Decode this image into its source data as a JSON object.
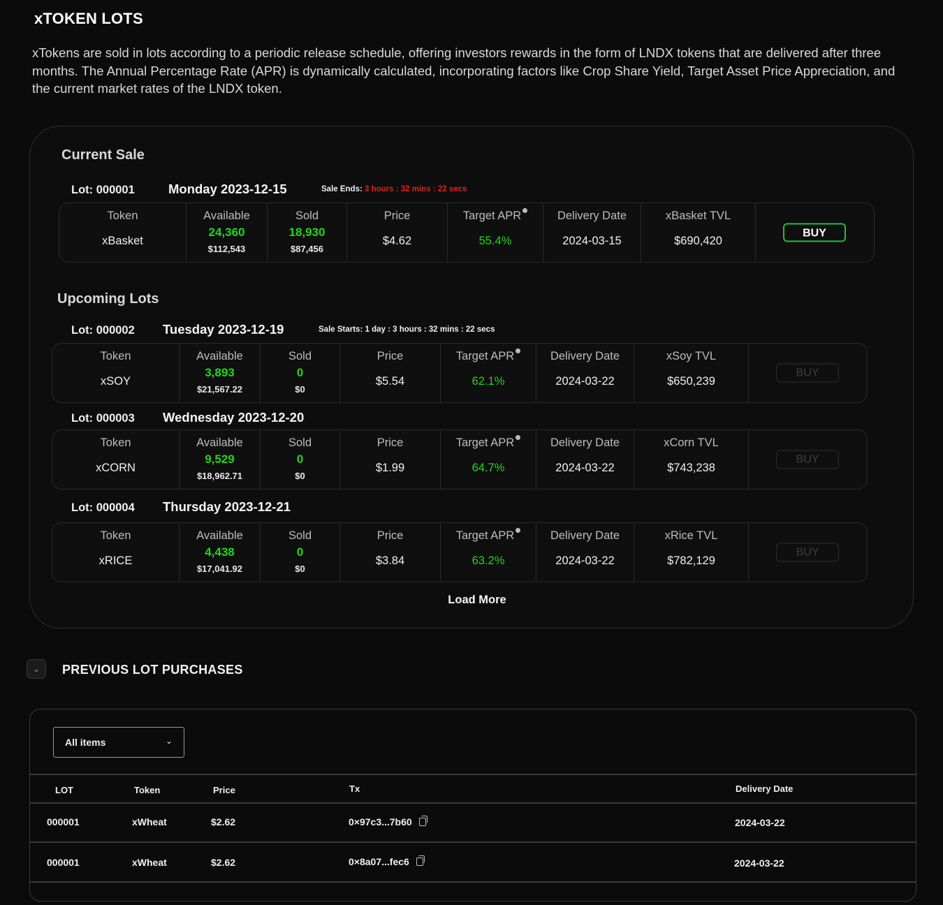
{
  "header": {
    "title": "xTOKEN LOTS",
    "description": "xTokens are sold in lots according to a periodic release schedule, offering investors rewards in the form of LNDX tokens that are delivered after three months. The Annual Percentage Rate (APR) is dynamically calculated, incorporating factors like Crop Share Yield, Target Asset Price Appreciation, and the current market rates of the LNDX token."
  },
  "current_sale": {
    "section_title": "Current Sale",
    "lot_label": "Lot: 000001",
    "date": "Monday 2023-12-15",
    "sale_ends_label": "Sale Ends:",
    "sale_ends_value": "3 hours : 32 mins : 22 secs",
    "row": {
      "token_label": "Token",
      "token": "xBasket",
      "available_label": "Available",
      "available": "24,360",
      "available_usd": "$112,543",
      "sold_label": "Sold",
      "sold": "18,930",
      "sold_usd": "$87,456",
      "price_label": "Price",
      "price": "$4.62",
      "apr_label": "Target APR",
      "apr": "55.4%",
      "delivery_label": "Delivery Date",
      "delivery": "2024-03-15",
      "tvl_label": "xBasket TVL",
      "tvl": "$690,420",
      "buy_label": "BUY"
    }
  },
  "upcoming": {
    "section_title": "Upcoming Lots",
    "lots": [
      {
        "lot_label": "Lot: 000002",
        "date": "Tuesday 2023-12-19",
        "sale_starts": "Sale Starts: 1 day : 3 hours : 32 mins : 22 secs",
        "token_label": "Token",
        "token": "xSOY",
        "available_label": "Available",
        "available": "3,893",
        "available_usd": "$21,567.22",
        "sold_label": "Sold",
        "sold": "0",
        "sold_usd": "$0",
        "price_label": "Price",
        "price": "$5.54",
        "apr_label": "Target APR",
        "apr": "62.1%",
        "delivery_label": "Delivery Date",
        "delivery": "2024-03-22",
        "tvl_label": "xSoy TVL",
        "tvl": "$650,239",
        "buy_label": "BUY"
      },
      {
        "lot_label": "Lot: 000003",
        "date": "Wednesday 2023-12-20",
        "token_label": "Token",
        "token": "xCORN",
        "available_label": "Available",
        "available": "9,529",
        "available_usd": "$18,962.71",
        "sold_label": "Sold",
        "sold": "0",
        "sold_usd": "$0",
        "price_label": "Price",
        "price": "$1.99",
        "apr_label": "Target APR",
        "apr": "64.7%",
        "delivery_label": "Delivery Date",
        "delivery": "2024-03-22",
        "tvl_label": "xCorn TVL",
        "tvl": "$743,238",
        "buy_label": "BUY"
      },
      {
        "lot_label": "Lot: 000004",
        "date": "Thursday 2023-12-21",
        "token_label": "Token",
        "token": "xRICE",
        "available_label": "Available",
        "available": "4,438",
        "available_usd": "$17,041.92",
        "sold_label": "Sold",
        "sold": "0",
        "sold_usd": "$0",
        "price_label": "Price",
        "price": "$3.84",
        "apr_label": "Target APR",
        "apr": "63.2%",
        "delivery_label": "Delivery Date",
        "delivery": "2024-03-22",
        "tvl_label": "xRice TVL",
        "tvl": "$782,129",
        "buy_label": "BUY"
      }
    ],
    "load_more": "Load More"
  },
  "previous": {
    "title": "PREVIOUS LOT PURCHASES",
    "filter_value": "All items",
    "columns": {
      "lot": "LOT",
      "token": "Token",
      "price": "Price",
      "tx": "Tx",
      "delivery": "Delivery Date"
    },
    "rows": [
      {
        "lot": "000001",
        "token": "xWheat",
        "price": "$2.62",
        "tx": "0×97c3...7b60",
        "delivery": "2024-03-22"
      },
      {
        "lot": "000001",
        "token": "xWheat",
        "price": "$2.62",
        "tx": "0×8a07...fec6",
        "delivery": "2024-03-22"
      }
    ]
  },
  "colors": {
    "accent_green": "#22d61a",
    "countdown_red": "#e0201d",
    "background": "#0b0b0b"
  },
  "icons": {
    "collapse": "chevron-down-icon",
    "copy": "copy-icon",
    "info": "info-dot-icon"
  }
}
